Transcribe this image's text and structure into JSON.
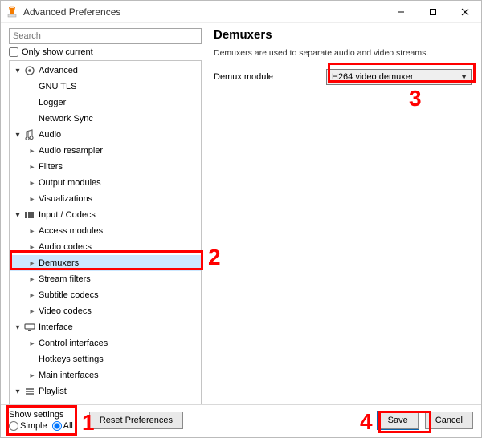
{
  "window": {
    "title": "Advanced Preferences"
  },
  "search": {
    "placeholder": "Search"
  },
  "sidebar": {
    "only_current": "Only show current",
    "items": {
      "advanced": "Advanced",
      "gnutls": "GNU TLS",
      "logger": "Logger",
      "network_sync": "Network Sync",
      "audio": "Audio",
      "audio_resampler": "Audio resampler",
      "filters": "Filters",
      "output_modules": "Output modules",
      "visualizations": "Visualizations",
      "input_codecs": "Input / Codecs",
      "access_modules": "Access modules",
      "audio_codecs": "Audio codecs",
      "demuxers": "Demuxers",
      "stream_filters": "Stream filters",
      "subtitle_codecs": "Subtitle codecs",
      "video_codecs": "Video codecs",
      "interface": "Interface",
      "control_interfaces": "Control interfaces",
      "hotkeys_settings": "Hotkeys settings",
      "main_interfaces": "Main interfaces",
      "playlist": "Playlist"
    }
  },
  "main": {
    "heading": "Demuxers",
    "description": "Demuxers are used to separate audio and video streams.",
    "demux_label": "Demux module",
    "demux_value": "H264 video demuxer"
  },
  "footer": {
    "show_settings": "Show settings",
    "simple": "Simple",
    "all": "All",
    "reset": "Reset Preferences",
    "save": "Save",
    "cancel": "Cancel"
  },
  "callouts": {
    "c1": "1",
    "c2": "2",
    "c3": "3",
    "c4": "4"
  }
}
